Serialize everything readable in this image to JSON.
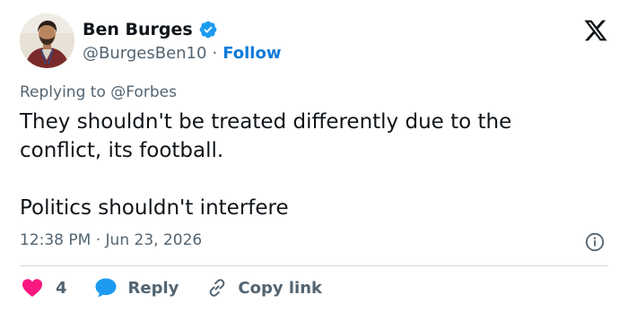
{
  "author": {
    "name": "Ben Burges",
    "handle": "@BurgesBen10",
    "separator": "·",
    "follow_label": "Follow"
  },
  "reply": {
    "prefix": "Replying to",
    "to": "@Forbes"
  },
  "tweet": {
    "line1": "They shouldn't be treated differently due to the conflict, its football.",
    "line2": "Politics shouldn't interfere"
  },
  "meta": {
    "time": "12:38 PM",
    "separator": "·",
    "date": "Jun 23, 2026"
  },
  "actions": {
    "like_count": "4",
    "reply_label": "Reply",
    "copy_label": "Copy link"
  },
  "colors": {
    "accent": "#1d9bf0",
    "like": "#f91880",
    "text": "#0f1419",
    "muted": "#536471"
  },
  "icons": [
    "verified-badge-icon",
    "x-logo-icon",
    "info-icon",
    "heart-icon",
    "reply-bubble-icon",
    "link-icon"
  ]
}
